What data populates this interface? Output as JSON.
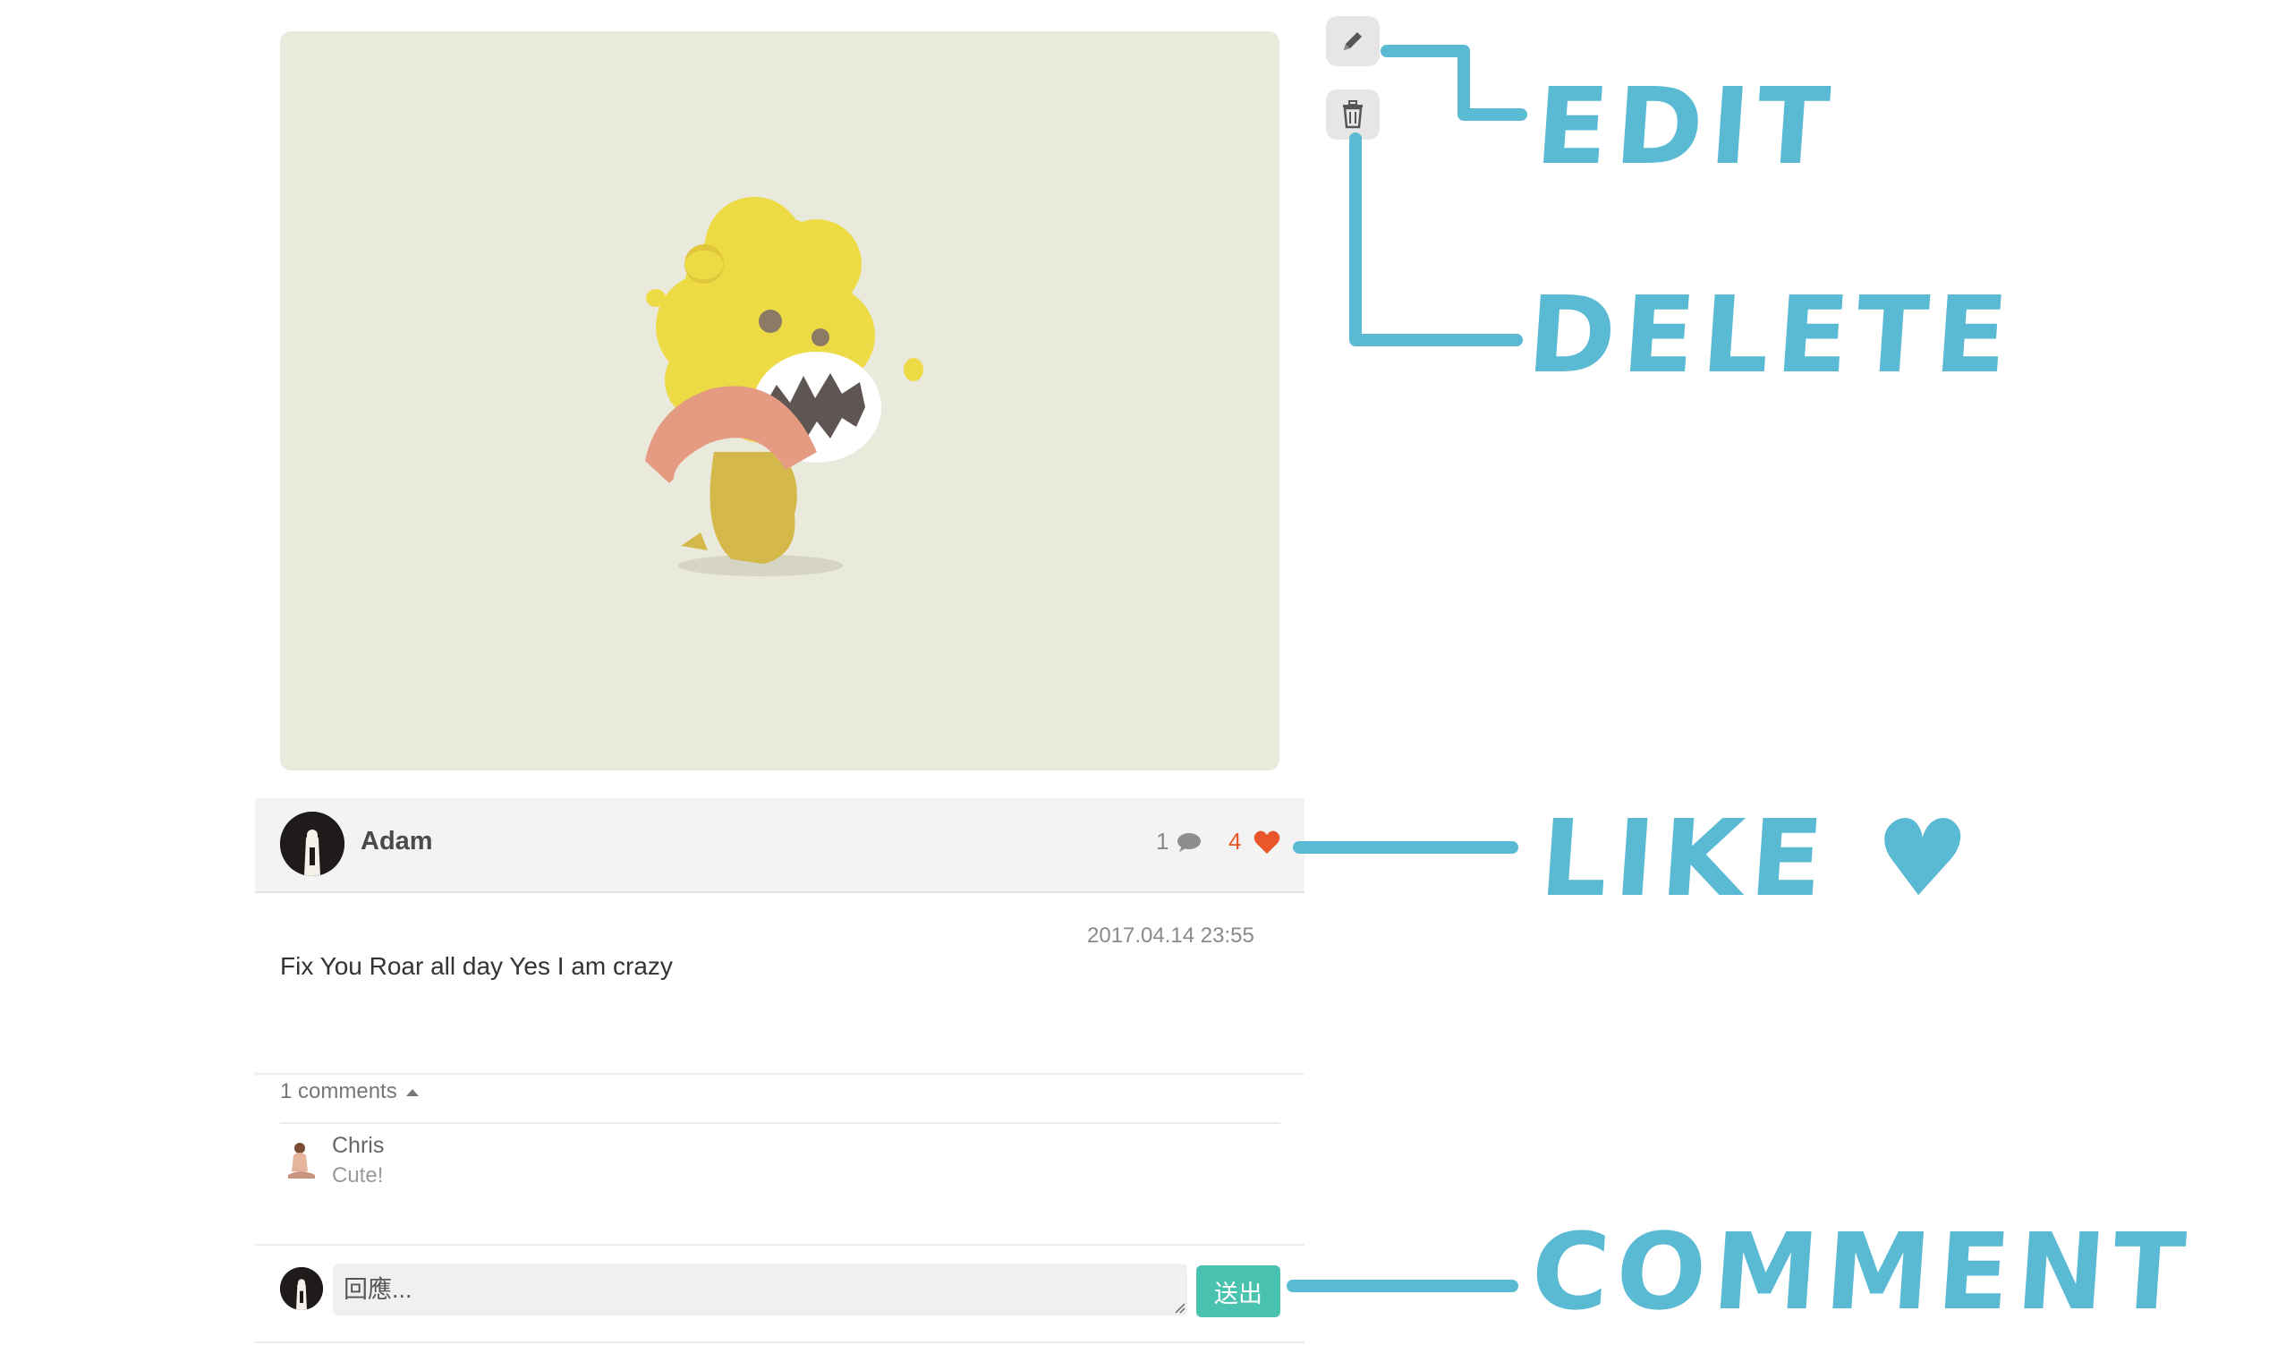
{
  "post": {
    "author": "Adam",
    "comment_count": "1",
    "like_count": "4",
    "date": "2017.04.14 23:55",
    "text": "Fix You Roar all day Yes I am crazy"
  },
  "comments": {
    "toggle_label": "1 comments",
    "items": [
      {
        "author": "Chris",
        "text": "Cute!"
      }
    ]
  },
  "reply": {
    "placeholder": "回應...",
    "send_label": "送出"
  },
  "annotations": {
    "edit": "EDIT",
    "delete": "DELETE",
    "like": "LIKE ♥",
    "comment": "COMMENT"
  },
  "colors": {
    "annotation": "#5ab9d3",
    "like": "#e8562a",
    "send_button": "#49c2b0",
    "image_background": "#e9e9dc"
  },
  "icons": [
    "pencil-icon",
    "trash-icon",
    "comment-bubble-icon",
    "heart-icon",
    "caret-up-icon",
    "resize-handle-icon"
  ]
}
